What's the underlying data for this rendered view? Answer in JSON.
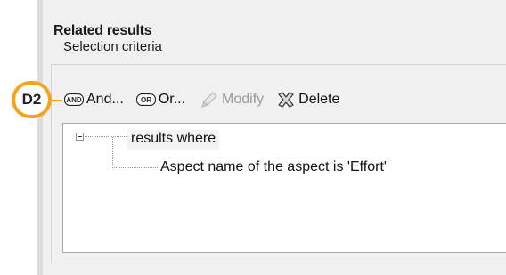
{
  "section": {
    "title": "Related results",
    "subtitle": "Selection criteria"
  },
  "callout": {
    "label": "D2",
    "color": "#f3a31c"
  },
  "toolbar": {
    "and_icon_text": "AND",
    "and_label": "And...",
    "or_icon_text": "OR",
    "or_label": "Or...",
    "modify_label": "Modify",
    "delete_label": "Delete"
  },
  "tree": {
    "root_label": "results where",
    "child_label": "Aspect name of the aspect is 'Effort'"
  }
}
